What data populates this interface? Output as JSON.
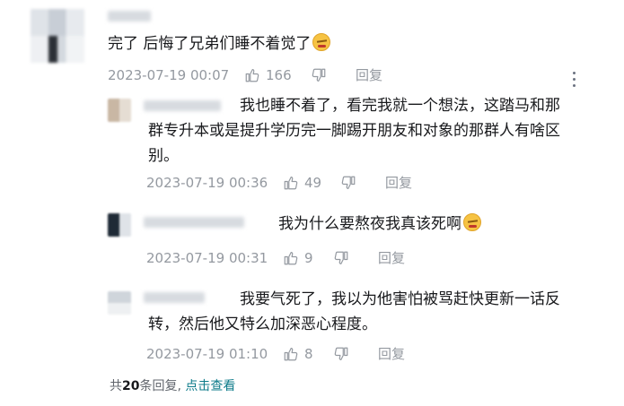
{
  "main_comment": {
    "text": "完了 后悔了兄弟们睡不着觉了",
    "date": "2023-07-19 00:07",
    "likes": "166",
    "reply_label": "回复"
  },
  "replies": [
    {
      "text_lines": [
        "我也睡不着了，看完我就一个想法，这踏马和那",
        "群专升本或是提升学历完一脚踢开朋友和对象的那群人有啥区",
        "别。"
      ],
      "date": "2023-07-19 00:36",
      "likes": "49",
      "reply_label": "回复"
    },
    {
      "text": "我为什么要熬夜我真该死啊",
      "date": "2023-07-19 00:31",
      "likes": "9",
      "reply_label": "回复"
    },
    {
      "text_lines": [
        "我要气死了，我以为他害怕被骂赶快更新一话反",
        "转，然后他又特么加深恶心程度。"
      ],
      "date": "2023-07-19 01:10",
      "likes": "8",
      "reply_label": "回复"
    }
  ],
  "footer": {
    "prefix": "共",
    "count": "20",
    "suffix": "条回复,",
    "view_link": "点击查看"
  },
  "icons": {
    "like": "thumb-up-icon",
    "dislike": "thumb-down-icon",
    "emoji": "tired-face-emoji-icon",
    "more": "more-vertical-icon"
  },
  "colors": {
    "meta_text": "#9499a0",
    "link": "#0d7b8a"
  }
}
